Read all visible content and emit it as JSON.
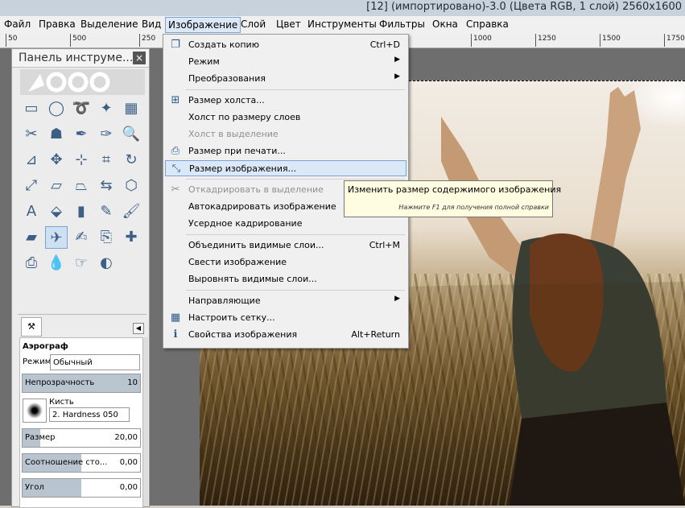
{
  "window": {
    "title": "[12] (импортировано)-3.0 (Цвета RGB, 1 слой) 2560x1600"
  },
  "menubar": [
    "Файл",
    "Правка",
    "Выделение",
    "Вид",
    "Изображение",
    "Слой",
    "Цвет",
    "Инструменты",
    "Фильтры",
    "Окна",
    "Справка"
  ],
  "ruler_labels": [
    "50",
    "500",
    "250",
    "1000",
    "1250",
    "1500",
    "1750"
  ],
  "toolbox": {
    "title": "Панель инструме...",
    "close": "×",
    "tools": [
      "rect-select",
      "ellipse-select",
      "free-select",
      "fuzzy-select",
      "color-select",
      "scissors-select",
      "foreground-select",
      "paths",
      "color-picker",
      "zoom",
      "measure",
      "move",
      "align",
      "crop",
      "rotate",
      "scale",
      "shear",
      "perspective",
      "flip",
      "cage-transform",
      "text",
      "bucket-fill",
      "blend",
      "pencil",
      "paintbrush",
      "eraser",
      "airbrush",
      "ink",
      "clone",
      "heal",
      "perspective-clone",
      "blur",
      "smudge",
      "dodge-burn"
    ],
    "selected_tool": "airbrush"
  },
  "tool_options": {
    "tool_name": "Аэрограф",
    "mode_label": "Режим:",
    "mode_value": "Обычный",
    "opacity_label": "Непрозрачность",
    "opacity_value": "10",
    "opacity_fraction": 1.0,
    "brush_label": "Кисть",
    "brush_value": "2. Hardness 050",
    "size_label": "Размер",
    "size_value": "20,00",
    "size_fraction": 0.15,
    "ratio_label": "Соотношение сто...",
    "ratio_value": "0,00",
    "ratio_fraction": 0.5,
    "angle_label": "Угол",
    "angle_value": "0,00",
    "angle_fraction": 0.5
  },
  "image_menu": {
    "items": [
      {
        "label": "Создать копию",
        "shortcut": "Ctrl+D",
        "icon": "duplicate-icon",
        "glyph": "❐"
      },
      {
        "label": "Режим",
        "submenu": true
      },
      {
        "label": "Преобразования",
        "submenu": true
      },
      {
        "sep": true
      },
      {
        "label": "Размер холста...",
        "icon": "canvas-size-icon",
        "glyph": "⊞"
      },
      {
        "label": "Холст по размеру слоев"
      },
      {
        "label": "Холст в выделение",
        "disabled": true
      },
      {
        "label": "Размер при печати...",
        "icon": "print-size-icon",
        "glyph": "⎙"
      },
      {
        "label": "Размер изображения...",
        "icon": "scale-image-icon",
        "glyph": "⤡",
        "highlighted": true
      },
      {
        "sep": true
      },
      {
        "label": "Откадрировать в выделение",
        "icon": "crop-icon",
        "glyph": "✂",
        "disabled": true
      },
      {
        "label": "Автокадрировать изображение"
      },
      {
        "label": "Усердное кадрирование"
      },
      {
        "sep": true
      },
      {
        "label": "Объединить видимые слои...",
        "shortcut": "Ctrl+M"
      },
      {
        "label": "Свести изображение"
      },
      {
        "label": "Выровнять видимые слои..."
      },
      {
        "sep": true
      },
      {
        "label": "Направляющие",
        "submenu": true
      },
      {
        "label": "Настроить сетку...",
        "icon": "grid-icon",
        "glyph": "▦"
      },
      {
        "label": "Свойства изображения",
        "shortcut": "Alt+Return",
        "icon": "info-icon",
        "glyph": "ℹ"
      }
    ]
  },
  "tooltip": {
    "title": "Изменить размер содержимого изображения",
    "hint": "Нажмите F1 для получения полной справки"
  }
}
